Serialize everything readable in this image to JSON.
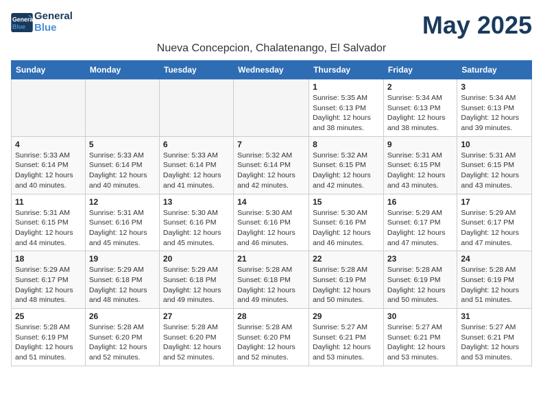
{
  "logo": {
    "text_general": "General",
    "text_blue": "Blue"
  },
  "title": "May 2025",
  "location": "Nueva Concepcion, Chalatenango, El Salvador",
  "weekdays": [
    "Sunday",
    "Monday",
    "Tuesday",
    "Wednesday",
    "Thursday",
    "Friday",
    "Saturday"
  ],
  "weeks": [
    [
      {
        "day": "",
        "info": ""
      },
      {
        "day": "",
        "info": ""
      },
      {
        "day": "",
        "info": ""
      },
      {
        "day": "",
        "info": ""
      },
      {
        "day": "1",
        "info": "Sunrise: 5:35 AM\nSunset: 6:13 PM\nDaylight: 12 hours\nand 38 minutes."
      },
      {
        "day": "2",
        "info": "Sunrise: 5:34 AM\nSunset: 6:13 PM\nDaylight: 12 hours\nand 38 minutes."
      },
      {
        "day": "3",
        "info": "Sunrise: 5:34 AM\nSunset: 6:13 PM\nDaylight: 12 hours\nand 39 minutes."
      }
    ],
    [
      {
        "day": "4",
        "info": "Sunrise: 5:33 AM\nSunset: 6:14 PM\nDaylight: 12 hours\nand 40 minutes."
      },
      {
        "day": "5",
        "info": "Sunrise: 5:33 AM\nSunset: 6:14 PM\nDaylight: 12 hours\nand 40 minutes."
      },
      {
        "day": "6",
        "info": "Sunrise: 5:33 AM\nSunset: 6:14 PM\nDaylight: 12 hours\nand 41 minutes."
      },
      {
        "day": "7",
        "info": "Sunrise: 5:32 AM\nSunset: 6:14 PM\nDaylight: 12 hours\nand 42 minutes."
      },
      {
        "day": "8",
        "info": "Sunrise: 5:32 AM\nSunset: 6:15 PM\nDaylight: 12 hours\nand 42 minutes."
      },
      {
        "day": "9",
        "info": "Sunrise: 5:31 AM\nSunset: 6:15 PM\nDaylight: 12 hours\nand 43 minutes."
      },
      {
        "day": "10",
        "info": "Sunrise: 5:31 AM\nSunset: 6:15 PM\nDaylight: 12 hours\nand 43 minutes."
      }
    ],
    [
      {
        "day": "11",
        "info": "Sunrise: 5:31 AM\nSunset: 6:15 PM\nDaylight: 12 hours\nand 44 minutes."
      },
      {
        "day": "12",
        "info": "Sunrise: 5:31 AM\nSunset: 6:16 PM\nDaylight: 12 hours\nand 45 minutes."
      },
      {
        "day": "13",
        "info": "Sunrise: 5:30 AM\nSunset: 6:16 PM\nDaylight: 12 hours\nand 45 minutes."
      },
      {
        "day": "14",
        "info": "Sunrise: 5:30 AM\nSunset: 6:16 PM\nDaylight: 12 hours\nand 46 minutes."
      },
      {
        "day": "15",
        "info": "Sunrise: 5:30 AM\nSunset: 6:16 PM\nDaylight: 12 hours\nand 46 minutes."
      },
      {
        "day": "16",
        "info": "Sunrise: 5:29 AM\nSunset: 6:17 PM\nDaylight: 12 hours\nand 47 minutes."
      },
      {
        "day": "17",
        "info": "Sunrise: 5:29 AM\nSunset: 6:17 PM\nDaylight: 12 hours\nand 47 minutes."
      }
    ],
    [
      {
        "day": "18",
        "info": "Sunrise: 5:29 AM\nSunset: 6:17 PM\nDaylight: 12 hours\nand 48 minutes."
      },
      {
        "day": "19",
        "info": "Sunrise: 5:29 AM\nSunset: 6:18 PM\nDaylight: 12 hours\nand 48 minutes."
      },
      {
        "day": "20",
        "info": "Sunrise: 5:29 AM\nSunset: 6:18 PM\nDaylight: 12 hours\nand 49 minutes."
      },
      {
        "day": "21",
        "info": "Sunrise: 5:28 AM\nSunset: 6:18 PM\nDaylight: 12 hours\nand 49 minutes."
      },
      {
        "day": "22",
        "info": "Sunrise: 5:28 AM\nSunset: 6:19 PM\nDaylight: 12 hours\nand 50 minutes."
      },
      {
        "day": "23",
        "info": "Sunrise: 5:28 AM\nSunset: 6:19 PM\nDaylight: 12 hours\nand 50 minutes."
      },
      {
        "day": "24",
        "info": "Sunrise: 5:28 AM\nSunset: 6:19 PM\nDaylight: 12 hours\nand 51 minutes."
      }
    ],
    [
      {
        "day": "25",
        "info": "Sunrise: 5:28 AM\nSunset: 6:19 PM\nDaylight: 12 hours\nand 51 minutes."
      },
      {
        "day": "26",
        "info": "Sunrise: 5:28 AM\nSunset: 6:20 PM\nDaylight: 12 hours\nand 52 minutes."
      },
      {
        "day": "27",
        "info": "Sunrise: 5:28 AM\nSunset: 6:20 PM\nDaylight: 12 hours\nand 52 minutes."
      },
      {
        "day": "28",
        "info": "Sunrise: 5:28 AM\nSunset: 6:20 PM\nDaylight: 12 hours\nand 52 minutes."
      },
      {
        "day": "29",
        "info": "Sunrise: 5:27 AM\nSunset: 6:21 PM\nDaylight: 12 hours\nand 53 minutes."
      },
      {
        "day": "30",
        "info": "Sunrise: 5:27 AM\nSunset: 6:21 PM\nDaylight: 12 hours\nand 53 minutes."
      },
      {
        "day": "31",
        "info": "Sunrise: 5:27 AM\nSunset: 6:21 PM\nDaylight: 12 hours\nand 53 minutes."
      }
    ]
  ]
}
